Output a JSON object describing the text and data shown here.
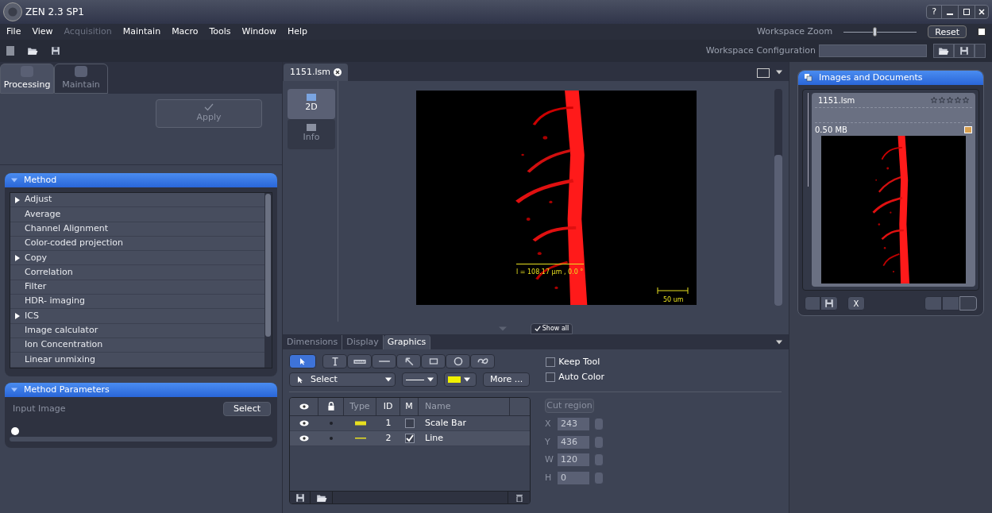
{
  "window": {
    "title": "ZEN 2.3 SP1",
    "help": "?"
  },
  "menu": [
    {
      "label": "File",
      "disabled": false
    },
    {
      "label": "View",
      "disabled": false
    },
    {
      "label": "Acquisition",
      "disabled": true
    },
    {
      "label": "Maintain",
      "disabled": false
    },
    {
      "label": "Macro",
      "disabled": false
    },
    {
      "label": "Tools",
      "disabled": false
    },
    {
      "label": "Window",
      "disabled": false
    },
    {
      "label": "Help",
      "disabled": false
    }
  ],
  "workspace_zoom": {
    "label": "Workspace Zoom",
    "level": 0.42,
    "reset": "Reset"
  },
  "workspace_configuration": {
    "label": "Workspace Configuration"
  },
  "left_tabs": [
    {
      "label": "Processing",
      "selected": true
    },
    {
      "label": "Maintain",
      "selected": false
    }
  ],
  "apply_button": {
    "label": "Apply",
    "disabled": true
  },
  "method": {
    "title": "Method",
    "items": [
      {
        "label": "Adjust",
        "expandable": true
      },
      {
        "label": "Average",
        "expandable": false
      },
      {
        "label": "Channel Alignment",
        "expandable": false
      },
      {
        "label": "Color-coded projection",
        "expandable": false
      },
      {
        "label": "Copy",
        "expandable": true
      },
      {
        "label": "Correlation",
        "expandable": false
      },
      {
        "label": "Filter",
        "expandable": false
      },
      {
        "label": "HDR- imaging",
        "expandable": false
      },
      {
        "label": "ICS",
        "expandable": true
      },
      {
        "label": "Image calculator",
        "expandable": false
      },
      {
        "label": "Ion Concentration",
        "expandable": false
      },
      {
        "label": "Linear unmixing",
        "expandable": false
      }
    ]
  },
  "method_parameters": {
    "title": "Method Parameters",
    "input_label": "Input Image",
    "button": "Select"
  },
  "document_tab": {
    "label": "1151.lsm"
  },
  "view_tabs": [
    {
      "label": "2D",
      "selected": true
    },
    {
      "label": "Info",
      "selected": false
    }
  ],
  "image_overlay": {
    "measurement": "l = 108.17 µm ,  0.0 °",
    "scale_label": "50 um"
  },
  "show_all": {
    "label": "Show all",
    "checked": true
  },
  "bottom_tabs": [
    {
      "label": "Dimensions",
      "selected": false
    },
    {
      "label": "Display",
      "selected": false
    },
    {
      "label": "Graphics",
      "selected": true
    }
  ],
  "tools": [
    {
      "kind": "select",
      "selected": true
    },
    {
      "kind": "text",
      "selected": false
    },
    {
      "kind": "scale",
      "selected": false
    },
    {
      "kind": "line",
      "selected": false
    },
    {
      "kind": "arrow",
      "selected": false
    },
    {
      "kind": "rectangle",
      "selected": false
    },
    {
      "kind": "circle",
      "selected": false
    },
    {
      "kind": "freehand",
      "selected": false
    }
  ],
  "select_dropdown": {
    "value": "Select"
  },
  "more_button": "More ...",
  "options": [
    {
      "label": "Keep Tool",
      "checked": false
    },
    {
      "label": "Auto Color",
      "checked": false
    }
  ],
  "graphics_table": {
    "columns": [
      "Type",
      "ID",
      "M",
      "Name"
    ],
    "rows": [
      {
        "kind": "scale",
        "id": "1",
        "marked": false,
        "name": "Scale Bar"
      },
      {
        "kind": "line",
        "id": "2",
        "marked": true,
        "name": "Line"
      }
    ]
  },
  "cut_region": {
    "label": "Cut region",
    "disabled": true
  },
  "coordinates": [
    {
      "label": "X",
      "value": "243"
    },
    {
      "label": "Y",
      "value": "436"
    },
    {
      "label": "W",
      "value": "120"
    },
    {
      "label": "H",
      "value": "0"
    }
  ],
  "images_panel": {
    "title": "Images and Documents",
    "document": {
      "name": "1151.lsm",
      "stars": 0,
      "size": "0.50 MB"
    },
    "close_button": "X"
  }
}
